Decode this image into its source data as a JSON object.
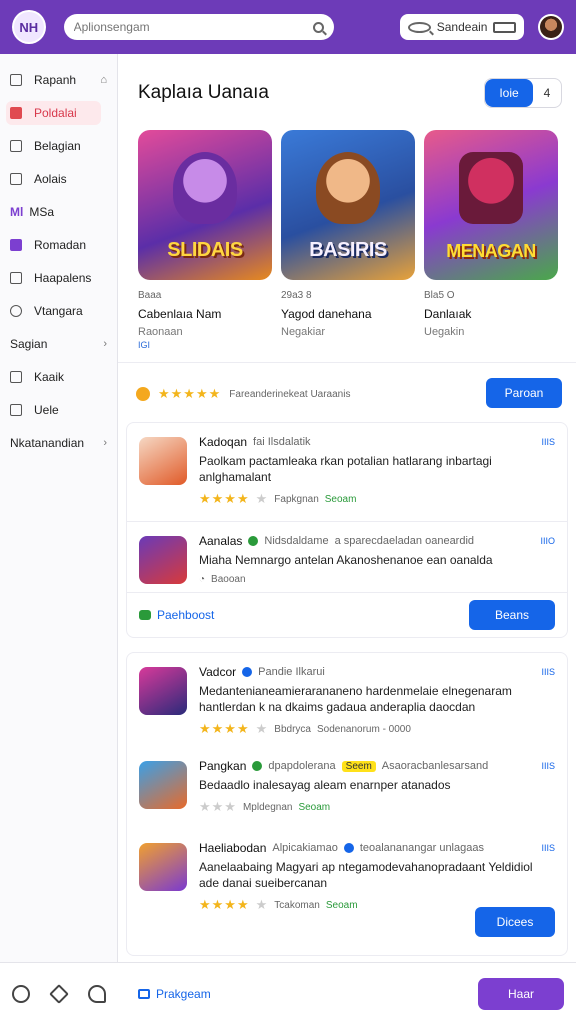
{
  "topbar": {
    "logo": "NH",
    "search_placeholder": "Aplionsengam",
    "secondary_search": "Sandeain",
    "accent": "#6d3bb8"
  },
  "sidebar": {
    "items": [
      {
        "label": "Rapanh",
        "icon": "grid-icon"
      },
      {
        "label": "Poldalai",
        "icon": "app-icon"
      },
      {
        "label": "Belagian",
        "icon": "doc-icon"
      },
      {
        "label": "Aolais",
        "icon": "chart-icon"
      },
      {
        "label": "MSa",
        "prefix": "Ml",
        "icon": "tag-icon"
      },
      {
        "label": "Romadan",
        "icon": "folder-icon"
      },
      {
        "label": "Haapalens",
        "icon": "list-icon"
      },
      {
        "label": "Vtangara",
        "icon": "gear-icon"
      },
      {
        "label": "Sagian",
        "icon": "chevron-right-icon"
      },
      {
        "label": "Kaaik",
        "icon": "box-icon"
      },
      {
        "label": "Uele",
        "icon": "gallery-icon"
      },
      {
        "label": "Nkatanandian",
        "icon": "chevron-right-icon"
      }
    ]
  },
  "main": {
    "title": "Kaplaıa Uanaıa",
    "toggle": {
      "active": "Ioie",
      "other": "4"
    },
    "cards": [
      {
        "art_word": "SLIDAIS",
        "meta": "Baaa",
        "name": "Cabenlaıa Nam",
        "sub": "Raonaan",
        "tiny": "IGI"
      },
      {
        "art_word": "BASIRIS",
        "meta": "29a3 8",
        "name": "Yagod danehana",
        "sub": "Negakiar",
        "tiny": ""
      },
      {
        "art_word": "MENAGAN",
        "meta": "Bla5 O",
        "name": "Danlaıak",
        "sub": "Uegakin",
        "tiny": ""
      }
    ],
    "rating": {
      "stars": "★★★★★",
      "text": "Fareanderinekeat Uaraanis",
      "button": "Paroan"
    },
    "reviews_a": [
      {
        "title": "Kadoqan",
        "badge": "fai Ilsdalatik",
        "corner": "IIIS",
        "text": "Paolkam pactamleaka rkan potalian hatlarang inbartagi anlghamalant",
        "stars": "★★★★",
        "grey": "★",
        "foot": "Fapkgnan",
        "foot_green": "Seoam"
      },
      {
        "title": "Aanalas",
        "badge": "Nidsdaldame",
        "corner": "IIIO",
        "text": "Miaha Nemnargo antelan Akanoshenanoe ean oanalda",
        "extra": "a sparecdaeladan oaneardid",
        "stars": "",
        "grey": "",
        "foot": "Baooan",
        "foot_green": ""
      }
    ],
    "panel_a_footer": {
      "link": "Paehboost",
      "button": "Beans"
    },
    "reviews_b": [
      {
        "title": "Vadcor",
        "badge": "Pandie Ilkarui",
        "corner": "IIIS",
        "text": "Medantenianeamierarananeno hardenmelaie elnegenaram hantlerdan k na dkaims gadaua anderaplia daocdan",
        "stars": "★★★★",
        "grey": "★",
        "foot": "Bbdryca",
        "foot_green": "Sodenanorum - 0000"
      },
      {
        "title": "Pangkan",
        "badge": "dpapdolerana",
        "tag": "Seem",
        "corner": "IIIS",
        "text": "Bedaadlo inalesayag aleam enarnper atanados",
        "extra": "Asaoracbanlesarsand",
        "stars": "",
        "grey": "★★★",
        "foot": "Mpldegnan",
        "foot_green": "Seoam"
      },
      {
        "title": "Haeliabodan",
        "badge": "Alpicakiamao",
        "corner": "IIIS",
        "text": "Aanelaabaing Magyari ap ntegamodevahanopradaant Yeldidiol ade danai sueibercanan",
        "extra": "teoalananangar unlagaas",
        "stars": "★★★★",
        "grey": "★",
        "foot": "Tcakoman",
        "foot_green": "Seoam"
      }
    ],
    "panel_b_button": "Dicees"
  },
  "bottombar": {
    "link": "Prakgeam",
    "button": "Haar"
  }
}
